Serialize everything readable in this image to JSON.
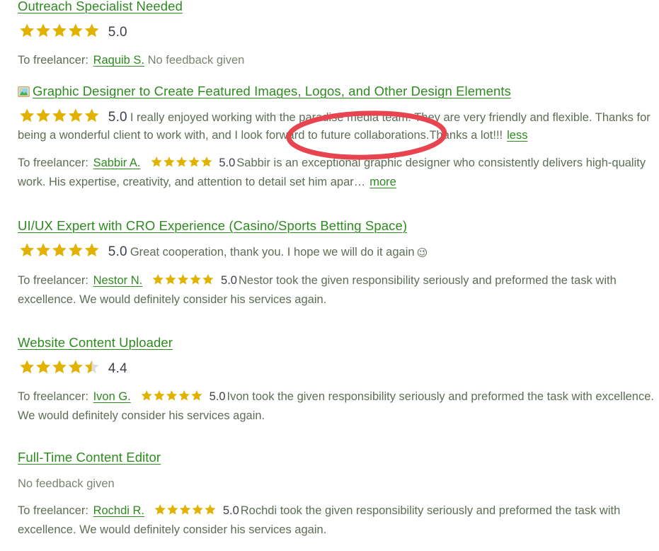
{
  "theme": {
    "link_green": "#2e8b1f",
    "star_gold": "#e2b203",
    "star_empty": "#dcdcdc",
    "body_gray": "#5e6d55",
    "value_dark": "#3c4249",
    "annotation_red": "#e63946"
  },
  "annotation": {
    "name": "red-ellipse-highlight",
    "shape": "ellipse",
    "color": "#e8444f",
    "highlighted_text": "the paradise media team"
  },
  "jobs": [
    {
      "title": "Outreach Specialist Needed",
      "icon": "",
      "rating": "5.0",
      "stars": 5,
      "feedback": "",
      "toggle": "",
      "no_feedback_standalone": "",
      "freelancer": {
        "label": "To freelancer:",
        "name": "Raquib S.",
        "stars": 0,
        "rating": "",
        "comment": "",
        "no_feedback": "No feedback given"
      }
    },
    {
      "title": "Graphic Designer to Create Featured Images, Logos, and Other Design Elements",
      "icon": "framed-picture-icon",
      "rating": "5.0",
      "stars": 5,
      "feedback": "I really enjoyed working with the paradise media team. They are very friendly and flexible. Thanks for being a wonderful client to work with, and I look forward to future collaborations.Thanks a lot!!!",
      "toggle": "less",
      "no_feedback_standalone": "",
      "freelancer": {
        "label": "To freelancer:",
        "name": "Sabbir A.",
        "stars": 5,
        "rating": "5.0",
        "comment": "Sabbir is an exceptional graphic designer who consistently delivers high-quality work. His expertise, creativity, and attention to detail set him apar…",
        "toggle": "more",
        "no_feedback": ""
      }
    },
    {
      "title": "UI/UX Expert with CRO Experience (Casino/Sports Betting Space)",
      "icon": "",
      "rating": "5.0",
      "stars": 5,
      "feedback": "Great cooperation, thank you. I hope we will do it again",
      "feedback_emoji": "😉",
      "toggle": "",
      "no_feedback_standalone": "",
      "freelancer": {
        "label": "To freelancer:",
        "name": "Nestor N.",
        "stars": 5,
        "rating": "5.0",
        "comment": "Nestor took the given responsibility seriously and preformed the task with excellence. We would definitely consider his services again.",
        "no_feedback": ""
      }
    },
    {
      "title": "Website Content Uploader",
      "icon": "",
      "rating": "4.4",
      "stars": 4.5,
      "feedback": "",
      "toggle": "",
      "no_feedback_standalone": "",
      "freelancer": {
        "label": "To freelancer:",
        "name": "Ivon G.",
        "stars": 5,
        "rating": "5.0",
        "comment": "Ivon took the given responsibility seriously and preformed the task with excellence. We would definitely consider his services again.",
        "no_feedback": ""
      }
    },
    {
      "title": "Full-Time Content Editor",
      "icon": "",
      "rating": "",
      "stars": 0,
      "feedback": "",
      "toggle": "",
      "no_feedback_standalone": "No feedback given",
      "freelancer": {
        "label": "To freelancer:",
        "name": "Rochdi R.",
        "stars": 5,
        "rating": "5.0",
        "comment": "Rochdi took the given responsibility seriously and preformed the task with excellence. We would definitely consider his services again.",
        "no_feedback": ""
      }
    }
  ]
}
